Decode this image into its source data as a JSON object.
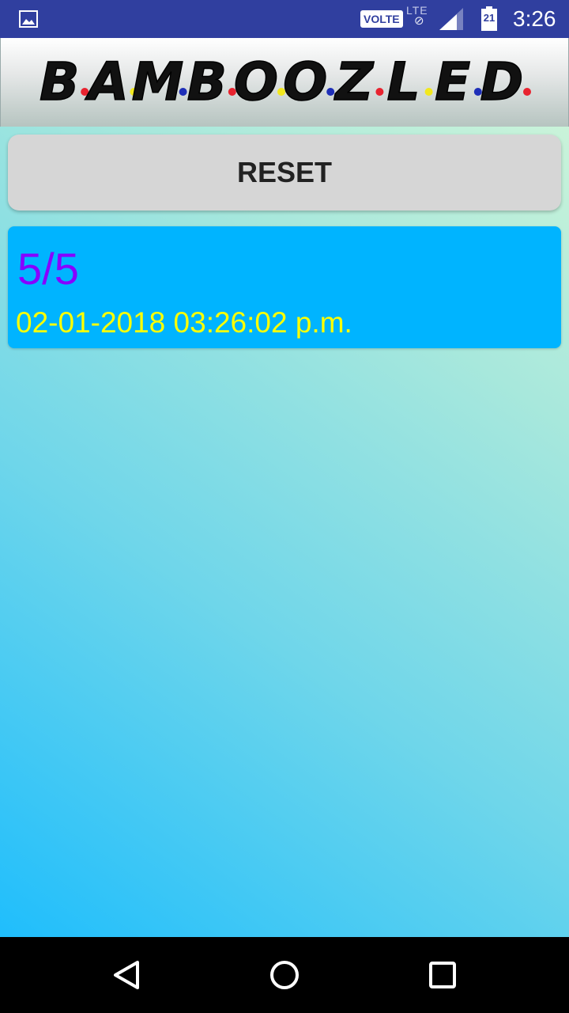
{
  "status_bar": {
    "notification_icon": "gallery-icon",
    "volte_label": "VOLTE",
    "network_label": "LTE",
    "signal_icon": "signal-icon",
    "battery_icon": "battery-icon",
    "battery_level": "21",
    "time": "3:26"
  },
  "header": {
    "logo_text": "BAMBOOZLED",
    "logo_dot_colors": [
      "#e8232f",
      "#f2e81e",
      "#1e2fb8"
    ]
  },
  "reset_button": {
    "label": "RESET"
  },
  "score_card": {
    "score": "5/5",
    "timestamp": "02-01-2018 03:26:02 p.m."
  },
  "nav_bar": {
    "back_icon": "back-triangle-icon",
    "home_icon": "home-circle-icon",
    "recents_icon": "recents-square-icon"
  },
  "colors": {
    "status_bar": "#303f9f",
    "card_background": "#00b4ff",
    "score_text": "#8800ff",
    "timestamp_text": "#ffff00",
    "button_background": "#d6d6d6"
  }
}
